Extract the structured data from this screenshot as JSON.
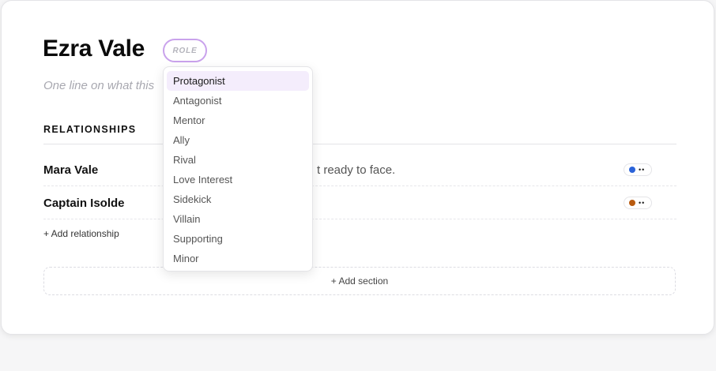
{
  "character": {
    "name": "Ezra Vale",
    "role_placeholder": "ROLE",
    "summary_placeholder": "One line on what this"
  },
  "relationships": {
    "label": "RELATIONSHIPS",
    "items": [
      {
        "name": "Mara Vale",
        "note": "t ready to face.",
        "dot_color": "#2b63d9"
      },
      {
        "name": "Captain Isolde",
        "note": "",
        "dot_color": "#b85a0f"
      }
    ],
    "add_label": "+ Add relationship"
  },
  "add_section_label": "+ Add section",
  "role_dropdown": {
    "selected": "Protagonist",
    "options": [
      "Protagonist",
      "Antagonist",
      "Mentor",
      "Ally",
      "Rival",
      "Love Interest",
      "Sidekick",
      "Villain",
      "Supporting",
      "Minor"
    ]
  },
  "colors": {
    "role_pill_border": "#c9a2ec",
    "active_option_bg": "#f4edfc"
  }
}
